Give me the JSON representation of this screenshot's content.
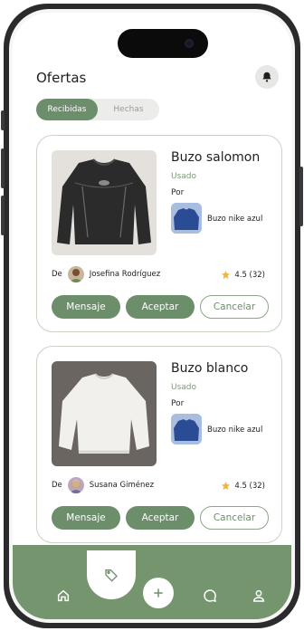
{
  "header": {
    "title": "Ofertas"
  },
  "tabs": [
    {
      "label": "Recibidas",
      "active": true
    },
    {
      "label": "Hechas",
      "active": false
    }
  ],
  "colors": {
    "accent": "#6d8e6b",
    "tabbar": "#75956f"
  },
  "offers": [
    {
      "item_name": "Buzo salomon",
      "condition": "Usado",
      "for_label": "Por",
      "offered_item": "Buzo nike azul",
      "from_label": "De",
      "from_name": "Josefina Rodríguez",
      "rating": "4.5 (32)",
      "buttons": {
        "message": "Mensaje",
        "accept": "Aceptar",
        "cancel": "Cancelar"
      }
    },
    {
      "item_name": "Buzo blanco",
      "condition": "Usado",
      "for_label": "Por",
      "offered_item": "Buzo nike azul",
      "from_label": "De",
      "from_name": "Susana Giménez",
      "rating": "4.5 (32)",
      "buttons": {
        "message": "Mensaje",
        "accept": "Aceptar",
        "cancel": "Cancelar"
      }
    }
  ],
  "bottom_nav": [
    {
      "icon": "home-icon"
    },
    {
      "icon": "tag-icon",
      "active": true
    },
    {
      "icon": "plus-icon"
    },
    {
      "icon": "chat-icon"
    },
    {
      "icon": "profile-icon"
    }
  ]
}
